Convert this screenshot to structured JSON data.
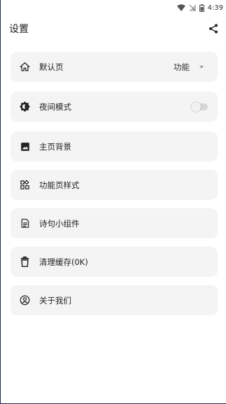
{
  "status_bar": {
    "time": "4:39"
  },
  "app_bar": {
    "title": "设置"
  },
  "settings": {
    "items": [
      {
        "label": "默认页",
        "value": "功能",
        "icon": "home-icon",
        "control": "dropdown"
      },
      {
        "label": "夜间模式",
        "icon": "brightness-icon",
        "control": "toggle",
        "toggle_on": false
      },
      {
        "label": "主页背景",
        "icon": "image-icon"
      },
      {
        "label": "功能页样式",
        "icon": "widgets-icon"
      },
      {
        "label": "诗句小组件",
        "icon": "document-icon"
      },
      {
        "label": "清理缓存(0K)",
        "icon": "trash-icon"
      },
      {
        "label": "关于我们",
        "icon": "account-circle-icon"
      }
    ]
  }
}
